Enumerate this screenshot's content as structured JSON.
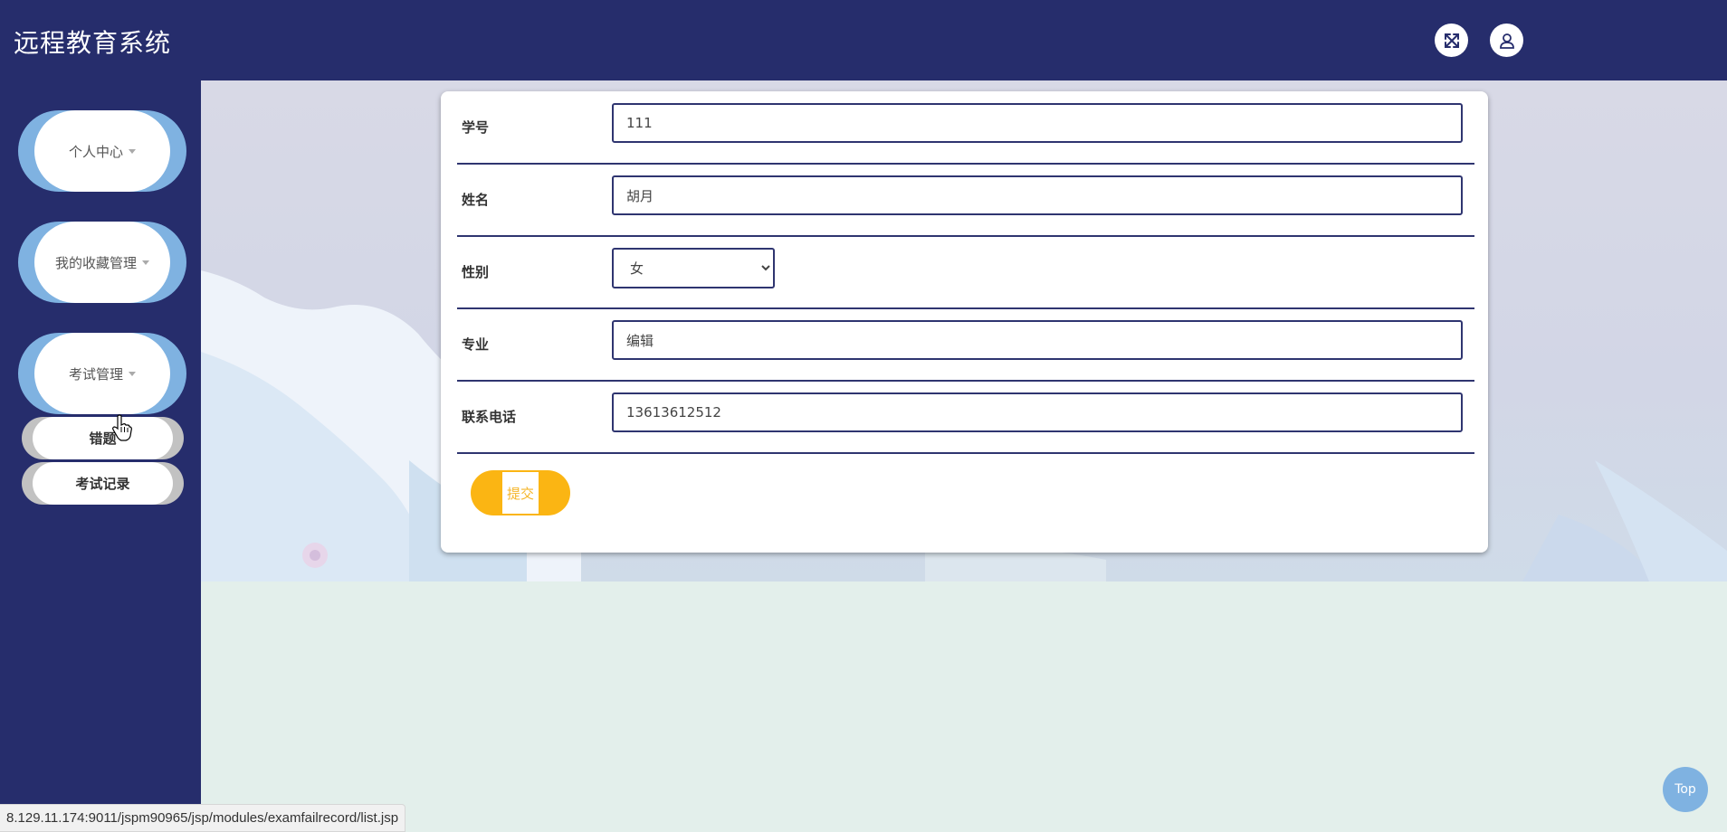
{
  "header": {
    "title": "远程教育系统",
    "icons": [
      "fullscreen-icon",
      "user-icon"
    ]
  },
  "sidebar": {
    "items": [
      {
        "label": "个人中心"
      },
      {
        "label": "我的收藏管理"
      },
      {
        "label": "考试管理"
      }
    ],
    "sub_items": [
      {
        "label": "错题"
      },
      {
        "label": "考试记录"
      }
    ]
  },
  "form": {
    "fields": [
      {
        "label": "学号",
        "value": "111"
      },
      {
        "label": "姓名",
        "value": "胡月"
      },
      {
        "label": "性别",
        "value": "女"
      },
      {
        "label": "专业",
        "value": "编辑"
      },
      {
        "label": "联系电话",
        "value": "13613612512"
      }
    ],
    "submit_label": "提交"
  },
  "status_bar": {
    "url": "8.129.11.174:9011/jspm90965/jsp/modules/examfailrecord/list.jsp"
  },
  "top_button": {
    "label": "Top"
  },
  "colors": {
    "header_bg": "#262d6c",
    "accent_blue": "#7fb2e1",
    "submit_yellow": "#fbb513",
    "content_bottom": "#e3efeb"
  }
}
